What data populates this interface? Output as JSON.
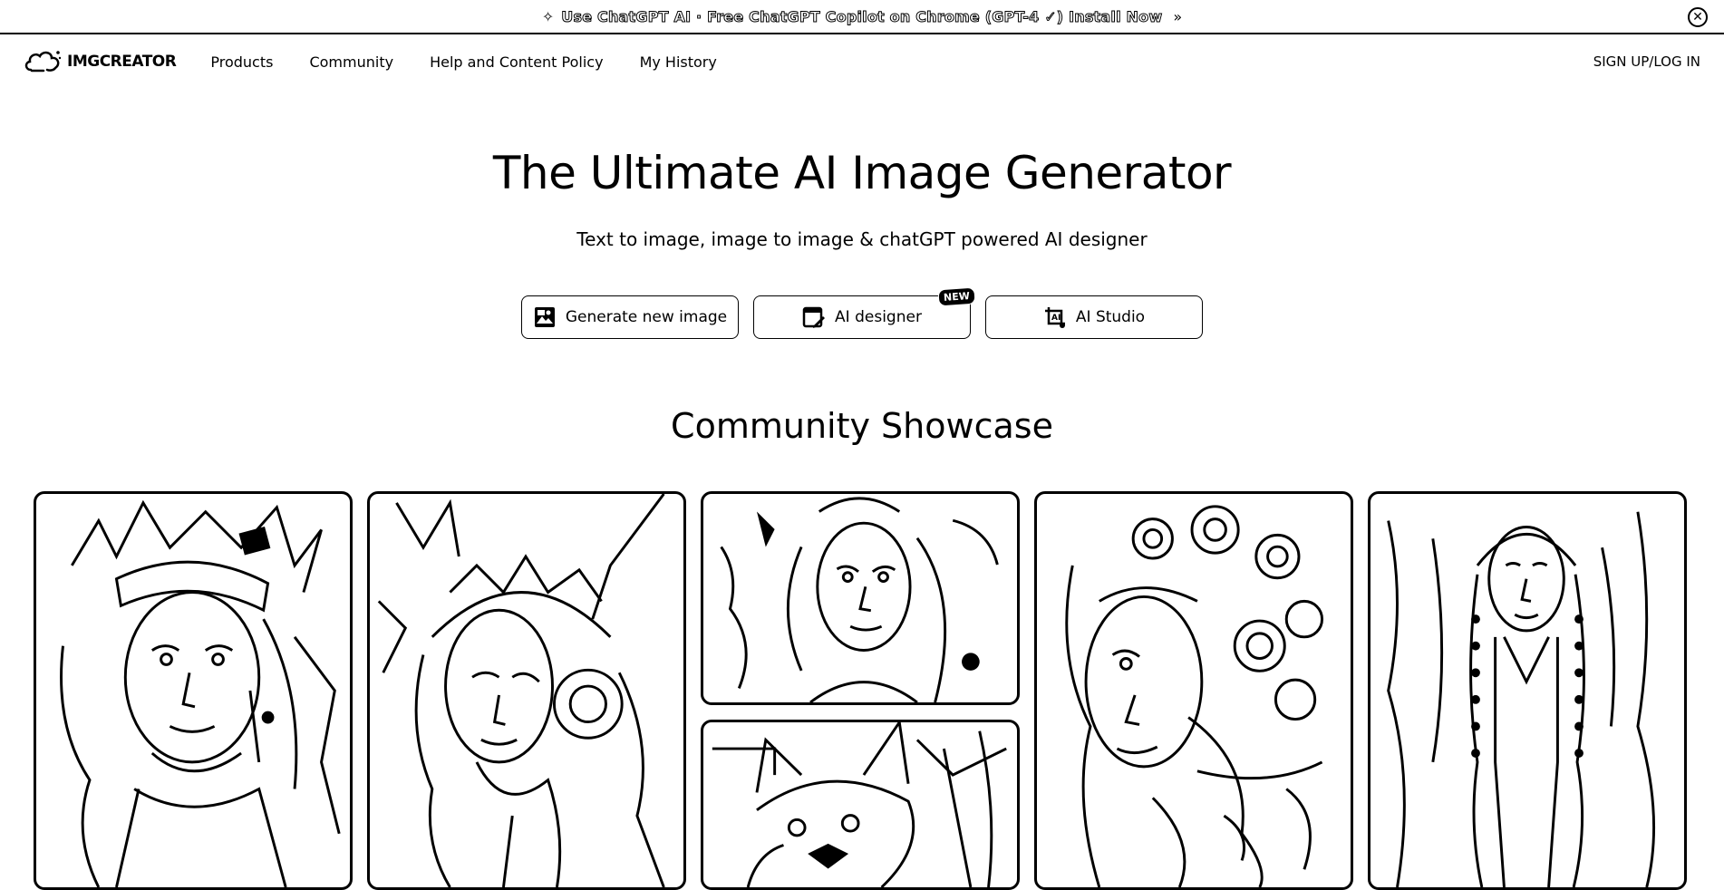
{
  "banner": {
    "text": "Use ChatGPT AI · Free ChatGPT Copilot on Chrome (GPT-4 ✓) Install Now",
    "arrow": "»",
    "sparkle": "✧",
    "close": "✕"
  },
  "header": {
    "logo_text": "IMGCREATOR",
    "nav": [
      "Products",
      "Community",
      "Help and Content Policy",
      "My History"
    ],
    "auth_label": "SIGN UP/LOG IN"
  },
  "hero": {
    "title": "The Ultimate AI Image Generator",
    "subtitle": "Text to image, image to image & chatGPT powered AI designer",
    "buttons": [
      {
        "label": "Generate new image",
        "icon": "image-icon"
      },
      {
        "label": "AI designer",
        "icon": "edit-icon",
        "badge": "NEW"
      },
      {
        "label": "AI Studio",
        "icon": "studio-icon"
      }
    ]
  },
  "showcase": {
    "title": "Community Showcase",
    "tiles": [
      {
        "subject": "woman-feather-headdress"
      },
      {
        "subject": "woman-horned-helmet"
      },
      {
        "subject": "woman-portrait-flowers"
      },
      {
        "subject": "dog-wolf"
      },
      {
        "subject": "woman-floral-hair"
      },
      {
        "subject": "woman-braids"
      }
    ]
  },
  "colors": {
    "ink": "#000000",
    "paper": "#ffffff"
  }
}
